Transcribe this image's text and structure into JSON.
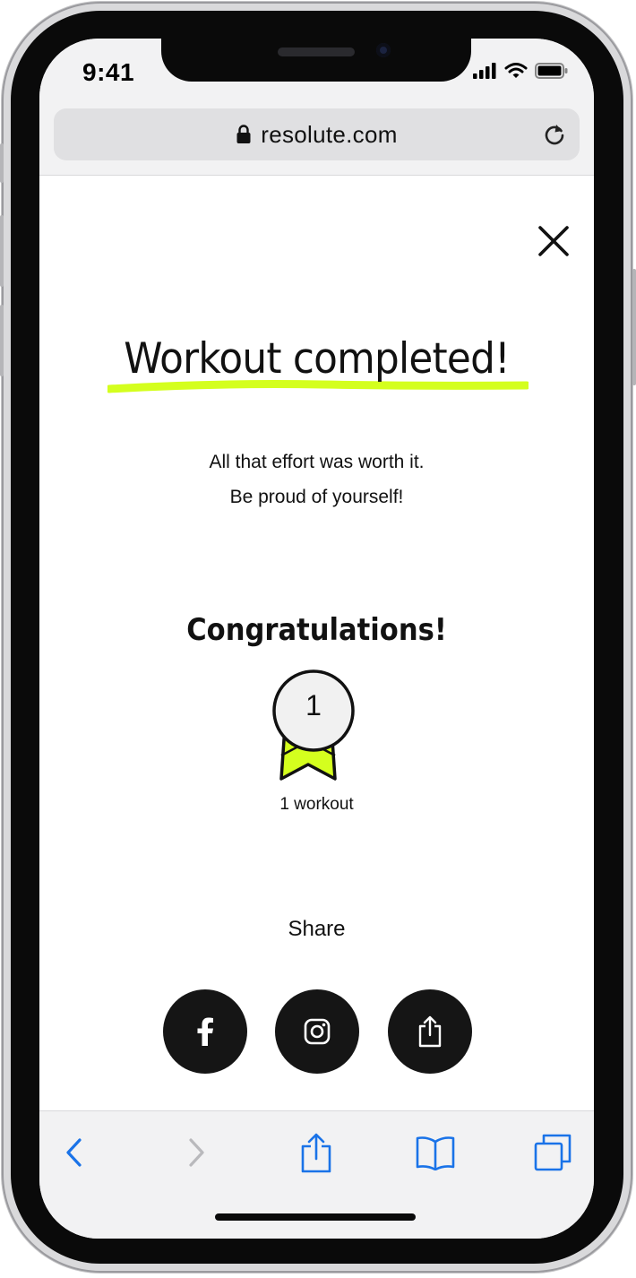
{
  "status_bar": {
    "time": "9:41",
    "icons": [
      "signal-icon",
      "wifi-icon",
      "battery-icon"
    ]
  },
  "browser": {
    "url": "resolute.com",
    "lock_icon": "lock-icon",
    "reload_icon": "reload-icon",
    "toolbar": [
      "back-icon",
      "forward-icon",
      "share-icon",
      "bookmarks-icon",
      "tabs-icon"
    ]
  },
  "page": {
    "title": "Workout completed!",
    "subtitle_line1": "All that effort was worth it.",
    "subtitle_line2": "Be proud of yourself!",
    "congrats": "Congratulations!",
    "medal": {
      "number": "1",
      "label": "1 workout"
    },
    "share": {
      "label": "Share",
      "buttons": [
        "facebook-icon",
        "instagram-icon",
        "share-icon"
      ]
    }
  },
  "colors": {
    "accent": "#d4ff1e",
    "dark": "#151515",
    "link_blue": "#1a73e8",
    "chrome_bg": "#f2f2f3"
  }
}
